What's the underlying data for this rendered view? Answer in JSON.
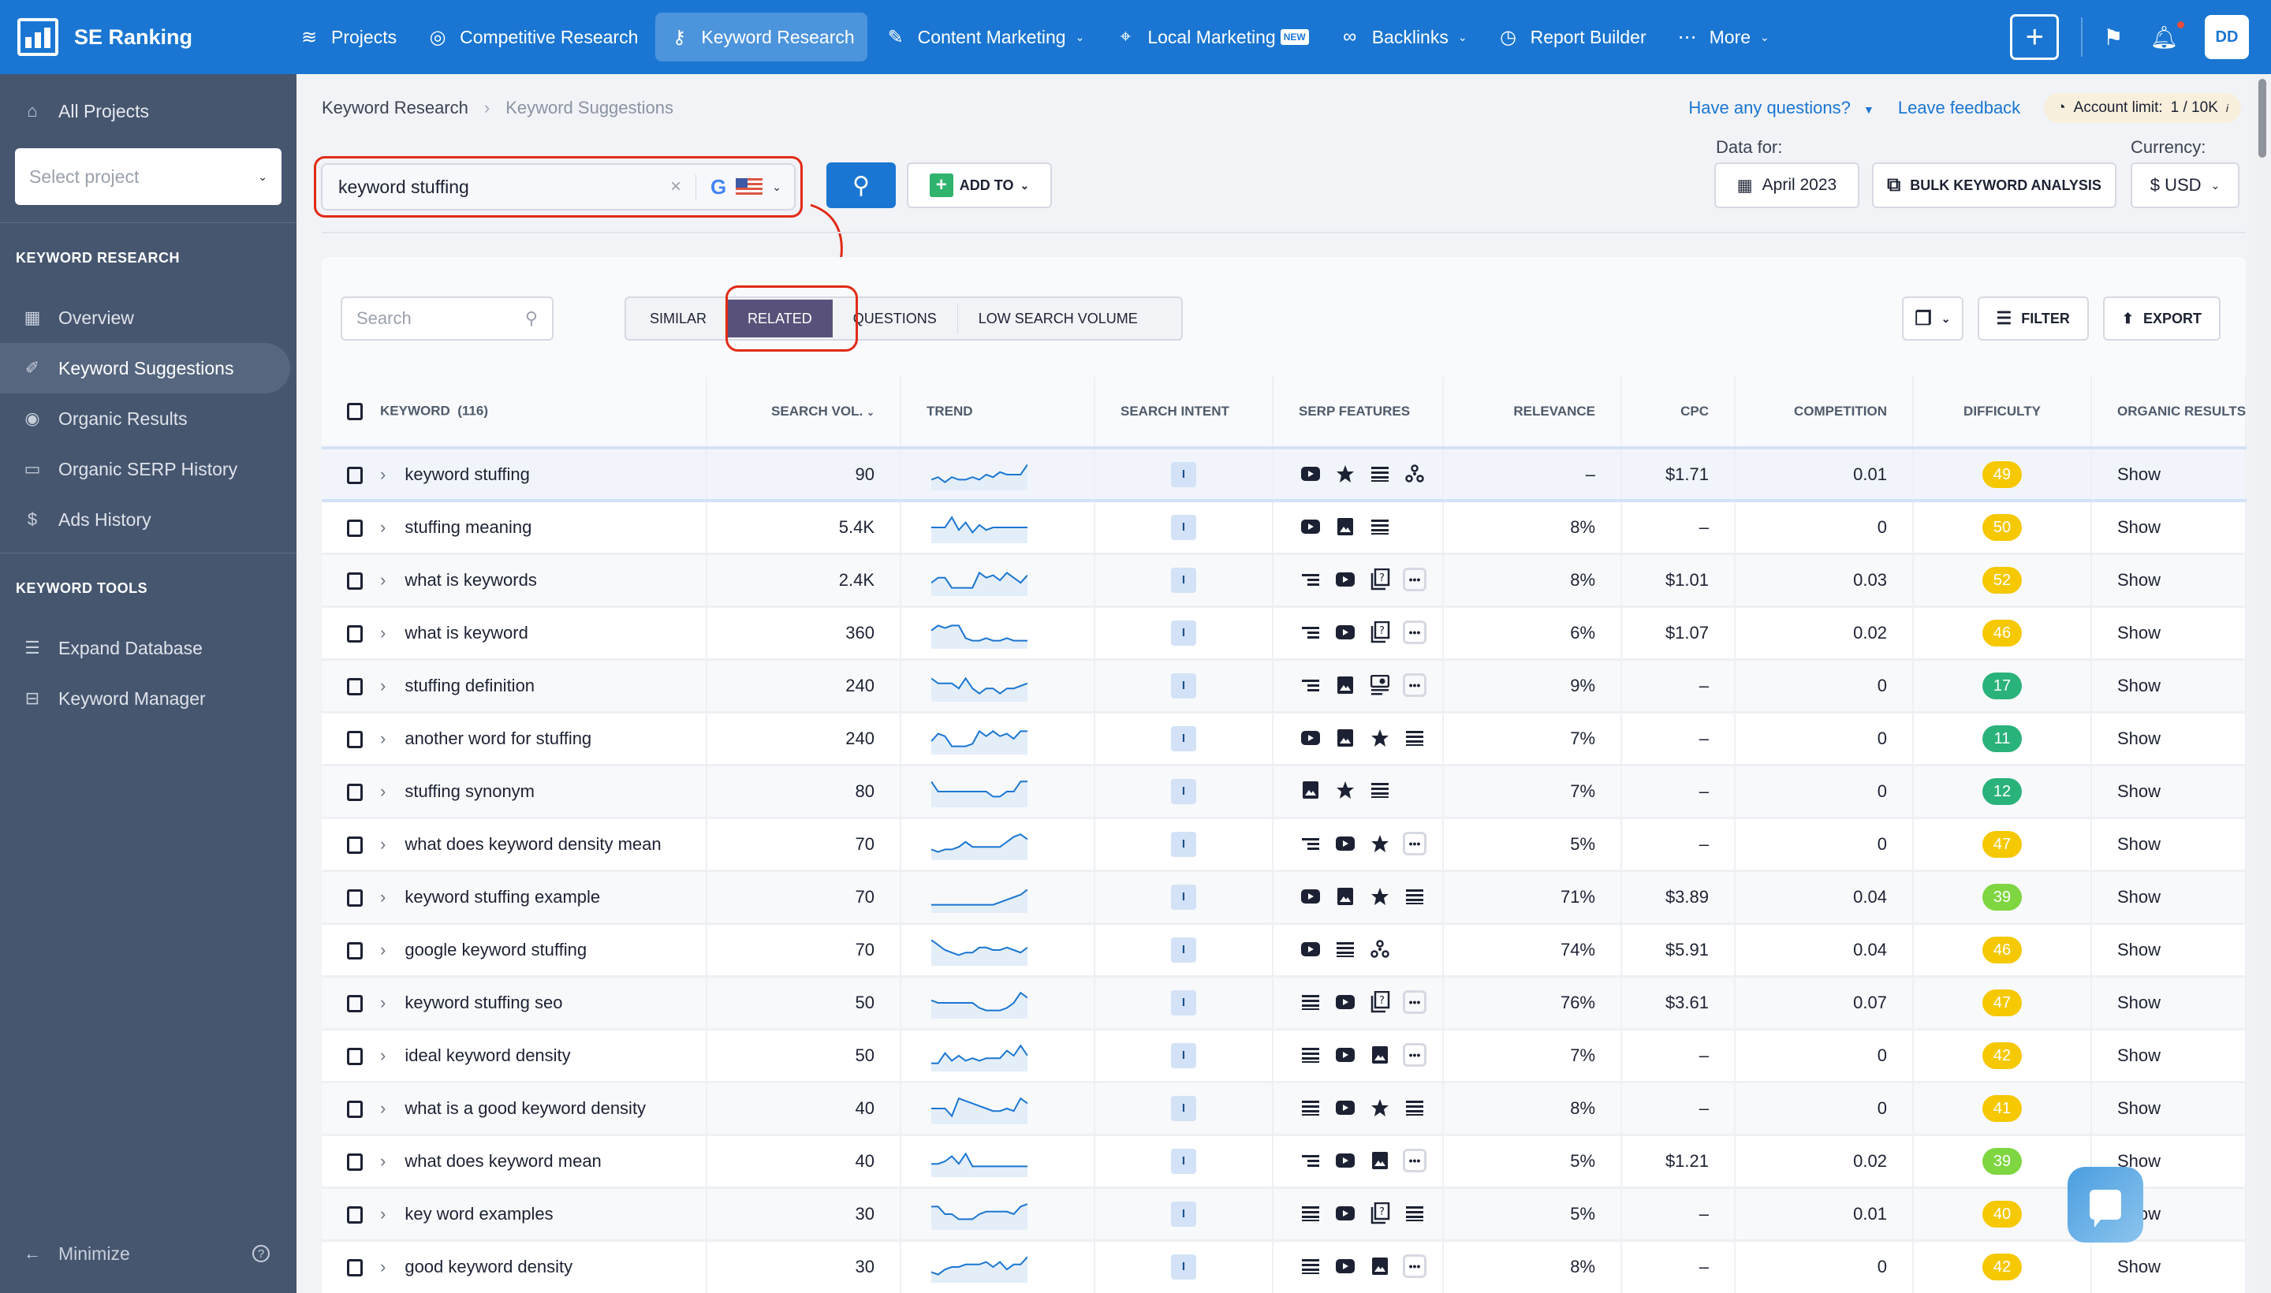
{
  "app": {
    "brand": "SE Ranking"
  },
  "topnav": {
    "items": [
      {
        "label": "Projects",
        "icon": "layers-icon",
        "active": false,
        "dropdown": false
      },
      {
        "label": "Competitive Research",
        "icon": "target-icon",
        "active": false,
        "dropdown": false
      },
      {
        "label": "Keyword Research",
        "icon": "key-icon",
        "active": true,
        "dropdown": false
      },
      {
        "label": "Content Marketing",
        "icon": "edit-icon",
        "active": false,
        "dropdown": true
      },
      {
        "label": "Local Marketing",
        "icon": "map-pin-icon",
        "active": false,
        "dropdown": false,
        "badge": "NEW"
      },
      {
        "label": "Backlinks",
        "icon": "link-icon",
        "active": false,
        "dropdown": true
      },
      {
        "label": "Report Builder",
        "icon": "pie-chart-icon",
        "active": false,
        "dropdown": false
      },
      {
        "label": "More",
        "icon": "dots-icon",
        "active": false,
        "dropdown": true
      }
    ],
    "avatar_initials": "DD"
  },
  "sidebar": {
    "all_projects": "All Projects",
    "select_placeholder": "Select project",
    "section1": "KEYWORD RESEARCH",
    "section1_items": [
      {
        "label": "Overview",
        "icon": "grid-icon"
      },
      {
        "label": "Keyword Suggestions",
        "icon": "pencil-icon",
        "active": true
      },
      {
        "label": "Organic Results",
        "icon": "eye-icon"
      },
      {
        "label": "Organic SERP History",
        "icon": "archive-icon"
      },
      {
        "label": "Ads History",
        "icon": "dollar-icon"
      }
    ],
    "section2": "KEYWORD TOOLS",
    "section2_items": [
      {
        "label": "Expand Database",
        "icon": "database-icon"
      },
      {
        "label": "Keyword Manager",
        "icon": "briefcase-icon"
      }
    ],
    "minimize": "Minimize"
  },
  "header": {
    "breadcrumb": [
      "Keyword Research",
      "Keyword Suggestions"
    ],
    "questions": "Have any questions?",
    "feedback": "Leave feedback",
    "account_limit_label": "Account limit:",
    "account_limit_value": "1 / 10K",
    "search_value": "keyword stuffing",
    "search_engine": "Google",
    "country": "US",
    "add_to": "ADD TO",
    "data_for_label": "Data for:",
    "date": "April 2023",
    "bulk": "BULK KEYWORD ANALYSIS",
    "currency_label": "Currency:",
    "currency": "$ USD"
  },
  "toolbar": {
    "search_placeholder": "Search",
    "tabs": [
      "SIMILAR",
      "RELATED",
      "QUESTIONS",
      "LOW SEARCH VOLUME"
    ],
    "active_tab": "RELATED",
    "filter": "FILTER",
    "export": "EXPORT"
  },
  "table": {
    "columns": [
      "KEYWORD",
      "(116)",
      "SEARCH VOL.",
      "TREND",
      "SEARCH INTENT",
      "SERP FEATURES",
      "RELEVANCE",
      "CPC",
      "COMPETITION",
      "DIFFICULTY",
      "ORGANIC RESULTS"
    ],
    "difficulty_colors": {
      "yellow": "#f5c800",
      "lightgreen": "#7ed640",
      "green": "#2ab27b"
    },
    "rows": [
      {
        "keyword": "keyword stuffing",
        "volume": "90",
        "trend": [
          3,
          4,
          2,
          4,
          3,
          3,
          4,
          3,
          5,
          4,
          6,
          5,
          5,
          5,
          9
        ],
        "intent": "I",
        "serp": [
          "video",
          "star",
          "list",
          "network"
        ],
        "more": false,
        "relevance": "–",
        "cpc": "$1.71",
        "competition": "0.01",
        "difficulty": "49",
        "diff_color": "yellow",
        "organic": "Show"
      },
      {
        "keyword": "stuffing meaning",
        "volume": "5.4K",
        "trend": [
          5,
          5,
          5,
          9,
          4,
          7,
          3,
          6,
          4,
          5,
          5,
          5,
          5,
          5,
          5
        ],
        "intent": "I",
        "serp": [
          "video",
          "image",
          "list"
        ],
        "more": false,
        "relevance": "8%",
        "cpc": "–",
        "competition": "0",
        "difficulty": "50",
        "diff_color": "yellow",
        "organic": "Show"
      },
      {
        "keyword": "what is keywords",
        "volume": "2.4K",
        "trend": [
          4,
          6,
          6,
          2,
          2,
          2,
          2,
          8,
          6,
          7,
          5,
          8,
          6,
          4,
          7
        ],
        "intent": "I",
        "serp": [
          "list-short",
          "video",
          "paa"
        ],
        "more": true,
        "relevance": "8%",
        "cpc": "$1.01",
        "competition": "0.03",
        "difficulty": "52",
        "diff_color": "yellow",
        "organic": "Show"
      },
      {
        "keyword": "what is keyword",
        "volume": "360",
        "trend": [
          6,
          8,
          7,
          8,
          8,
          3,
          2,
          2,
          3,
          2,
          2,
          3,
          2,
          2,
          2
        ],
        "intent": "I",
        "serp": [
          "list-short",
          "video",
          "paa"
        ],
        "more": true,
        "relevance": "6%",
        "cpc": "$1.07",
        "competition": "0.02",
        "difficulty": "46",
        "diff_color": "yellow",
        "organic": "Show"
      },
      {
        "keyword": "stuffing definition",
        "volume": "240",
        "trend": [
          8,
          6,
          6,
          6,
          4,
          8,
          4,
          2,
          4,
          4,
          2,
          4,
          4,
          5,
          6
        ],
        "intent": "I",
        "serp": [
          "list-short",
          "image",
          "knowledge"
        ],
        "more": true,
        "relevance": "9%",
        "cpc": "–",
        "competition": "0",
        "difficulty": "17",
        "diff_color": "green",
        "organic": "Show"
      },
      {
        "keyword": "another word for stuffing",
        "volume": "240",
        "trend": [
          4,
          7,
          6,
          2,
          2,
          2,
          3,
          8,
          6,
          8,
          6,
          7,
          5,
          8,
          8
        ],
        "intent": "I",
        "serp": [
          "video",
          "image",
          "star",
          "list"
        ],
        "more": false,
        "relevance": "7%",
        "cpc": "–",
        "competition": "0",
        "difficulty": "11",
        "diff_color": "green",
        "organic": "Show"
      },
      {
        "keyword": "stuffing synonym",
        "volume": "80",
        "trend": [
          9,
          5,
          5,
          5,
          5,
          5,
          5,
          5,
          5,
          3,
          3,
          5,
          5,
          9,
          9
        ],
        "intent": "I",
        "serp": [
          "image",
          "star",
          "list"
        ],
        "more": false,
        "relevance": "7%",
        "cpc": "–",
        "competition": "0",
        "difficulty": "12",
        "diff_color": "green",
        "organic": "Show"
      },
      {
        "keyword": "what does keyword density mean",
        "volume": "70",
        "trend": [
          3,
          2,
          3,
          3,
          4,
          6,
          4,
          4,
          4,
          4,
          4,
          6,
          8,
          9,
          7
        ],
        "intent": "I",
        "serp": [
          "list-short",
          "video",
          "star"
        ],
        "more": true,
        "relevance": "5%",
        "cpc": "–",
        "competition": "0",
        "difficulty": "47",
        "diff_color": "yellow",
        "organic": "Show"
      },
      {
        "keyword": "keyword stuffing example",
        "volume": "70",
        "trend": [
          2,
          2,
          2,
          2,
          2,
          2,
          2,
          2,
          2,
          2,
          3,
          4,
          5,
          6,
          8
        ],
        "intent": "I",
        "serp": [
          "video",
          "image",
          "star",
          "list"
        ],
        "more": false,
        "relevance": "71%",
        "cpc": "$3.89",
        "competition": "0.04",
        "difficulty": "39",
        "diff_color": "lightgreen",
        "organic": "Show"
      },
      {
        "keyword": "google keyword stuffing",
        "volume": "70",
        "trend": [
          9,
          7,
          5,
          4,
          3,
          4,
          4,
          6,
          6,
          5,
          5,
          6,
          5,
          4,
          6
        ],
        "intent": "I",
        "serp": [
          "video",
          "list",
          "network"
        ],
        "more": false,
        "relevance": "74%",
        "cpc": "$5.91",
        "competition": "0.04",
        "difficulty": "46",
        "diff_color": "yellow",
        "organic": "Show"
      },
      {
        "keyword": "keyword stuffing seo",
        "volume": "50",
        "trend": [
          6,
          5,
          5,
          5,
          5,
          5,
          5,
          3,
          2,
          2,
          2,
          3,
          5,
          9,
          7
        ],
        "intent": "I",
        "serp": [
          "list",
          "video",
          "paa"
        ],
        "more": true,
        "relevance": "76%",
        "cpc": "$3.61",
        "competition": "0.07",
        "difficulty": "47",
        "diff_color": "yellow",
        "organic": "Show"
      },
      {
        "keyword": "ideal keyword density",
        "volume": "50",
        "trend": [
          2,
          2,
          6,
          3,
          5,
          3,
          4,
          3,
          4,
          4,
          4,
          7,
          5,
          9,
          5
        ],
        "intent": "I",
        "serp": [
          "list",
          "video",
          "image"
        ],
        "more": true,
        "relevance": "7%",
        "cpc": "–",
        "competition": "0",
        "difficulty": "42",
        "diff_color": "yellow",
        "organic": "Show"
      },
      {
        "keyword": "what is a good keyword density",
        "volume": "40",
        "trend": [
          5,
          5,
          5,
          2,
          9,
          8,
          7,
          6,
          5,
          4,
          4,
          5,
          4,
          9,
          7
        ],
        "intent": "I",
        "serp": [
          "list",
          "video",
          "star",
          "list"
        ],
        "more": false,
        "relevance": "8%",
        "cpc": "–",
        "competition": "0",
        "difficulty": "41",
        "diff_color": "yellow",
        "organic": "Show"
      },
      {
        "keyword": "what does keyword mean",
        "volume": "40",
        "trend": [
          4,
          4,
          5,
          7,
          4,
          8,
          3,
          3,
          3,
          3,
          3,
          3,
          3,
          3,
          3
        ],
        "intent": "I",
        "serp": [
          "list-short",
          "video",
          "image"
        ],
        "more": true,
        "relevance": "5%",
        "cpc": "$1.21",
        "competition": "0.02",
        "difficulty": "39",
        "diff_color": "lightgreen",
        "organic": "Show"
      },
      {
        "keyword": "key word examples",
        "volume": "30",
        "trend": [
          8,
          8,
          5,
          5,
          3,
          3,
          3,
          5,
          6,
          6,
          6,
          6,
          5,
          8,
          9
        ],
        "intent": "I",
        "serp": [
          "list",
          "video",
          "paa",
          "list"
        ],
        "more": false,
        "relevance": "5%",
        "cpc": "–",
        "competition": "0.01",
        "difficulty": "40",
        "diff_color": "yellow",
        "organic": "Show"
      },
      {
        "keyword": "good keyword density",
        "volume": "30",
        "trend": [
          3,
          2,
          4,
          5,
          5,
          6,
          6,
          6,
          7,
          5,
          7,
          4,
          6,
          6,
          9
        ],
        "intent": "I",
        "serp": [
          "list",
          "video",
          "image"
        ],
        "more": true,
        "relevance": "8%",
        "cpc": "–",
        "competition": "0",
        "difficulty": "42",
        "diff_color": "yellow",
        "organic": "Show"
      }
    ]
  }
}
